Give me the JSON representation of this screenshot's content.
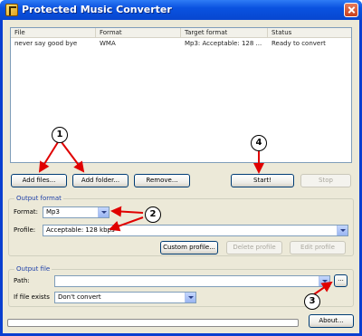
{
  "window": {
    "title": "Protected Music Converter"
  },
  "file_list": {
    "columns": [
      "File",
      "Format",
      "Target format",
      "Status"
    ],
    "rows": [
      {
        "file": "never say good bye",
        "format": "WMA",
        "target_format": "Mp3: Acceptable: 128 ...",
        "status": "Ready to convert"
      }
    ]
  },
  "buttons": {
    "add_files": "Add files...",
    "add_folder": "Add folder...",
    "remove": "Remove...",
    "start": "Start!",
    "stop": "Stop",
    "custom_profile": "Custom profile...",
    "delete_profile": "Delete profile",
    "edit_profile": "Edit profile",
    "browse": "...",
    "about": "About..."
  },
  "output_format": {
    "group_label": "Output format",
    "format_label": "Format:",
    "format_value": "Mp3",
    "profile_label": "Profile:",
    "profile_value": "Acceptable: 128 kbps"
  },
  "output_file": {
    "group_label": "Output file",
    "path_label": "Path:",
    "path_value": "",
    "if_exists_label": "If file exists",
    "if_exists_value": "Don't convert"
  },
  "progress": {
    "value": 0
  },
  "callouts": [
    "1",
    "2",
    "3",
    "4"
  ],
  "colors": {
    "titlebar": "#0a52e0",
    "annotation_arrow": "#e00000"
  }
}
